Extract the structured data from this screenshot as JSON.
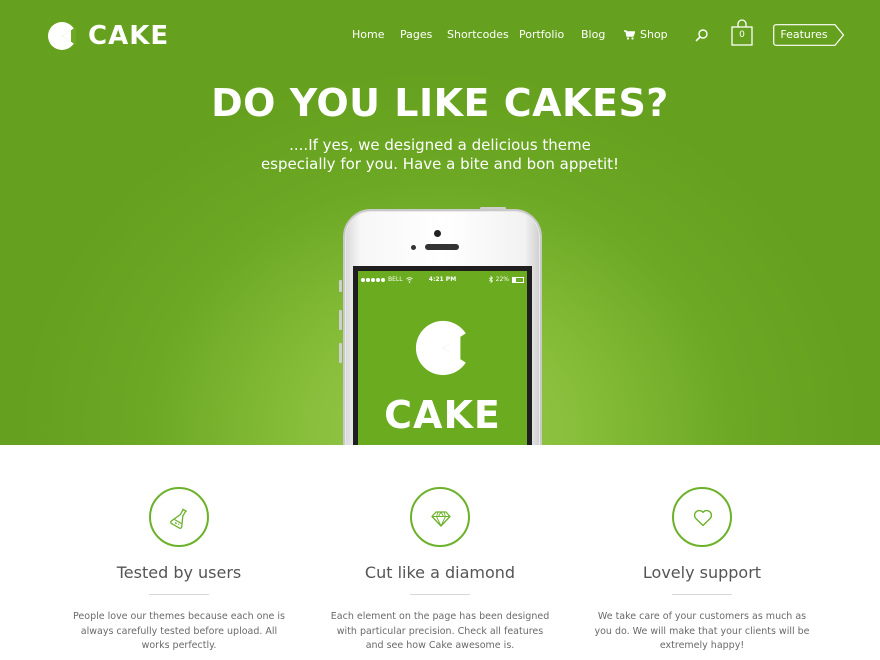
{
  "brand": {
    "name": "CAKE"
  },
  "nav": {
    "items": [
      {
        "label": "Home"
      },
      {
        "label": "Pages"
      },
      {
        "label": "Shortcodes"
      },
      {
        "label": "Portfolio"
      },
      {
        "label": "Blog"
      },
      {
        "label": "Shop",
        "icon": "shopping-cart-icon"
      }
    ],
    "search_icon": "magnifier-icon",
    "bag": {
      "icon": "shopping-bag-icon",
      "count": "0"
    },
    "features_button": "Features"
  },
  "hero": {
    "headline": "DO YOU LIKE CAKES?",
    "subline_1": "....If yes, we designed a delicious theme",
    "subline_2": "especially for you. Have a bite and bon appetit!",
    "phone": {
      "carrier": "BELL",
      "time": "4:21 PM",
      "battery": "22%",
      "screen_title": "CAKE"
    }
  },
  "features": [
    {
      "icon": "flask-icon",
      "title": "Tested by users",
      "text": "People love our themes because each one is always carefully tested before upload. All works perfectly."
    },
    {
      "icon": "diamond-icon",
      "title": "Cut like a diamond",
      "text": "Each element on the page has been designed with particular precision. Check all features and see how Cake awesome is."
    },
    {
      "icon": "heart-icon",
      "title": "Lovely support",
      "text": "We take care of your customers as much as you do. We will make that your clients will be extremely happy!"
    }
  ],
  "colors": {
    "brand_green": "#6ca824",
    "icon_green": "#6cb12a",
    "white": "#ffffff",
    "body_text": "#555555"
  }
}
